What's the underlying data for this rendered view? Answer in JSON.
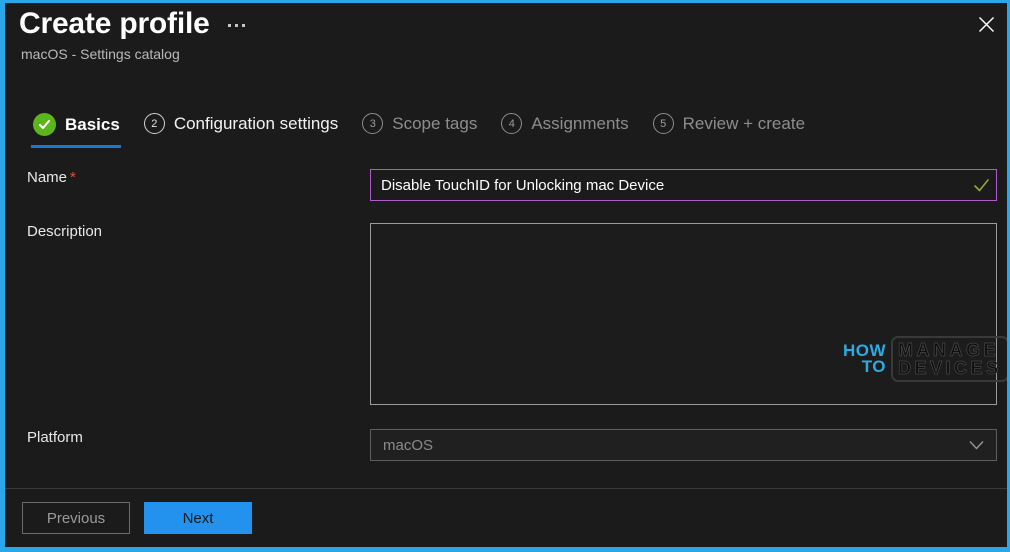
{
  "window": {
    "accent_border_color": "#29a7e8",
    "background_color": "#1b1b1b"
  },
  "header": {
    "title": "Create profile",
    "subtitle": "macOS - Settings catalog",
    "more_menu_icon": "ellipsis-icon",
    "close_icon": "close-icon"
  },
  "wizard": {
    "active_underline_color": "#1a79d4",
    "completed_color": "#5cb51b",
    "steps": [
      {
        "number": "1",
        "label": "Basics",
        "state": "completed"
      },
      {
        "number": "2",
        "label": "Configuration settings",
        "state": "enabled"
      },
      {
        "number": "3",
        "label": "Scope tags",
        "state": "disabled"
      },
      {
        "number": "4",
        "label": "Assignments",
        "state": "disabled"
      },
      {
        "number": "5",
        "label": "Review + create",
        "state": "disabled"
      }
    ]
  },
  "form": {
    "name": {
      "label": "Name",
      "required_marker": "*",
      "value": "Disable TouchID for Unlocking mac Device",
      "placeholder": "",
      "focus_border_color": "#b05ccd",
      "valid_icon": "checkmark-icon",
      "valid_icon_color": "#93a832"
    },
    "description": {
      "label": "Description",
      "value": "",
      "placeholder": ""
    },
    "platform": {
      "label": "Platform",
      "value": "macOS",
      "disabled": true,
      "chevron_icon": "chevron-down-icon"
    }
  },
  "watermark": {
    "line1": "HOW",
    "line2": "TO",
    "line3": "MANAGE",
    "line4": "DEVICES",
    "accent_color": "#2bb0ea"
  },
  "footer": {
    "previous_label": "Previous",
    "next_label": "Next",
    "next_color": "#2292ee"
  }
}
